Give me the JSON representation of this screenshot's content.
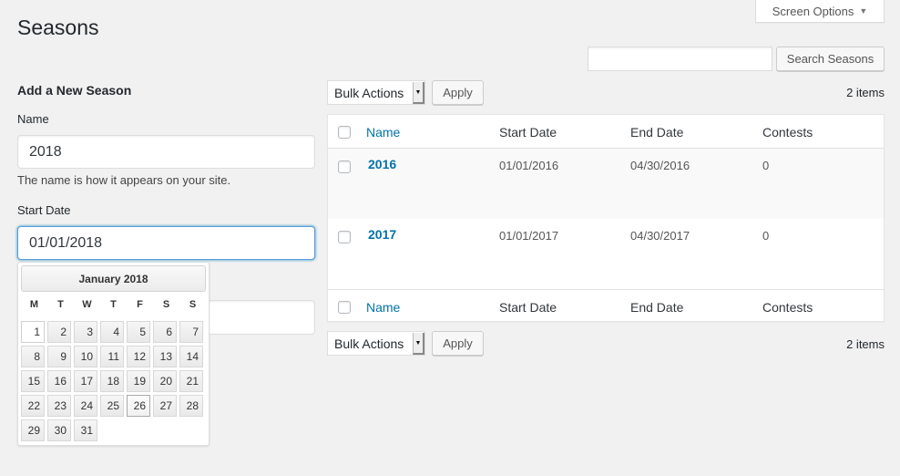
{
  "header": {
    "screen_options_label": "Screen Options",
    "screen_options_icon": "triangle-down-icon",
    "title": "Seasons"
  },
  "search": {
    "value": "",
    "placeholder": "",
    "button_label": "Search Seasons"
  },
  "form": {
    "title": "Add a New Season",
    "name_label": "Name",
    "name_value": "2018",
    "name_help": "The name is how it appears on your site.",
    "start_date_label": "Start Date",
    "start_date_value": "01/01/2018",
    "end_date_value": ""
  },
  "datepicker": {
    "month_label": "January 2018",
    "weekdays": [
      "M",
      "T",
      "W",
      "T",
      "F",
      "S",
      "S"
    ],
    "days": [
      "1",
      "2",
      "3",
      "4",
      "5",
      "6",
      "7",
      "8",
      "9",
      "10",
      "11",
      "12",
      "13",
      "14",
      "15",
      "16",
      "17",
      "18",
      "19",
      "20",
      "21",
      "22",
      "23",
      "24",
      "25",
      "26",
      "27",
      "28",
      "29",
      "30",
      "31"
    ],
    "selected_day": "1",
    "today": "26"
  },
  "toolbar": {
    "bulk_actions_label": "Bulk Actions",
    "apply_label": "Apply",
    "items_count": "2 items"
  },
  "table": {
    "columns": [
      "Name",
      "Start Date",
      "End Date",
      "Contests"
    ],
    "rows": [
      {
        "name": "2016",
        "start_date": "01/01/2016",
        "end_date": "04/30/2016",
        "contests": "0"
      },
      {
        "name": "2017",
        "start_date": "01/01/2017",
        "end_date": "04/30/2017",
        "contests": "0"
      }
    ]
  }
}
